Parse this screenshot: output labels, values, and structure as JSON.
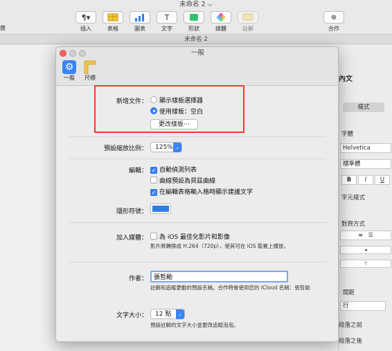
{
  "window": {
    "title": "未命名 2 ⌵",
    "doc_tab": "未命名 2"
  },
  "toolbar": {
    "left_label": "放",
    "insert": "插入",
    "table": "表格",
    "chart": "圖表",
    "text": "文字",
    "shape": "形狀",
    "media": "媒體",
    "comment": "註解",
    "collaborate": "合作"
  },
  "inspector": {
    "title": "內文",
    "style_tab": "樣式",
    "font_section": "字體",
    "font_name": "Helvetica",
    "font_style": "標準體",
    "b": "B",
    "i": "I",
    "u": "U",
    "char_style": "字元樣式",
    "align_section": "對齊方式",
    "spacing_section": "間距",
    "spacing_value": "行",
    "before": "段落之前",
    "after": "段落之後"
  },
  "prefs": {
    "title": "一般",
    "tabs": [
      {
        "label": "一般"
      },
      {
        "label": "尺標"
      }
    ],
    "new_doc_label": "新增文件：",
    "radio_chooser": "顯示樣板選擇器",
    "radio_template": "使用樣板：空白",
    "change_template": "更改樣板⋯",
    "zoom_label": "預設縮放比例：",
    "zoom_value": "125%",
    "editing_label": "編輯：",
    "cb_auto_list": "自動偵測列表",
    "cb_bezier": "曲線預設為貝茲曲線",
    "cb_suggestions": "在編輯表格輸入格時顯示建議文字",
    "invisibles_label": "隱形符號：",
    "invisibles_color": "#2f7fe6",
    "media_label": "加入媒體：",
    "cb_ios": "為 iOS 最佳化影片和影像",
    "ios_note": "影片將轉換成 H.264（720p），使其可在 iOS 裝置上播放。",
    "author_label": "作者：",
    "author_value": "張哲勛",
    "author_note": "註解和追蹤更動的預設名稱。合作時會使用您的 iCloud 名稱：張哲勛",
    "text_size_label": "文字大小：",
    "text_size_value": "12 點",
    "text_size_note": "預設註解的文字大小並更改追蹤泡泡。"
  },
  "colors": {
    "accent": "#3b85f5",
    "highlight": "#e8412a"
  }
}
